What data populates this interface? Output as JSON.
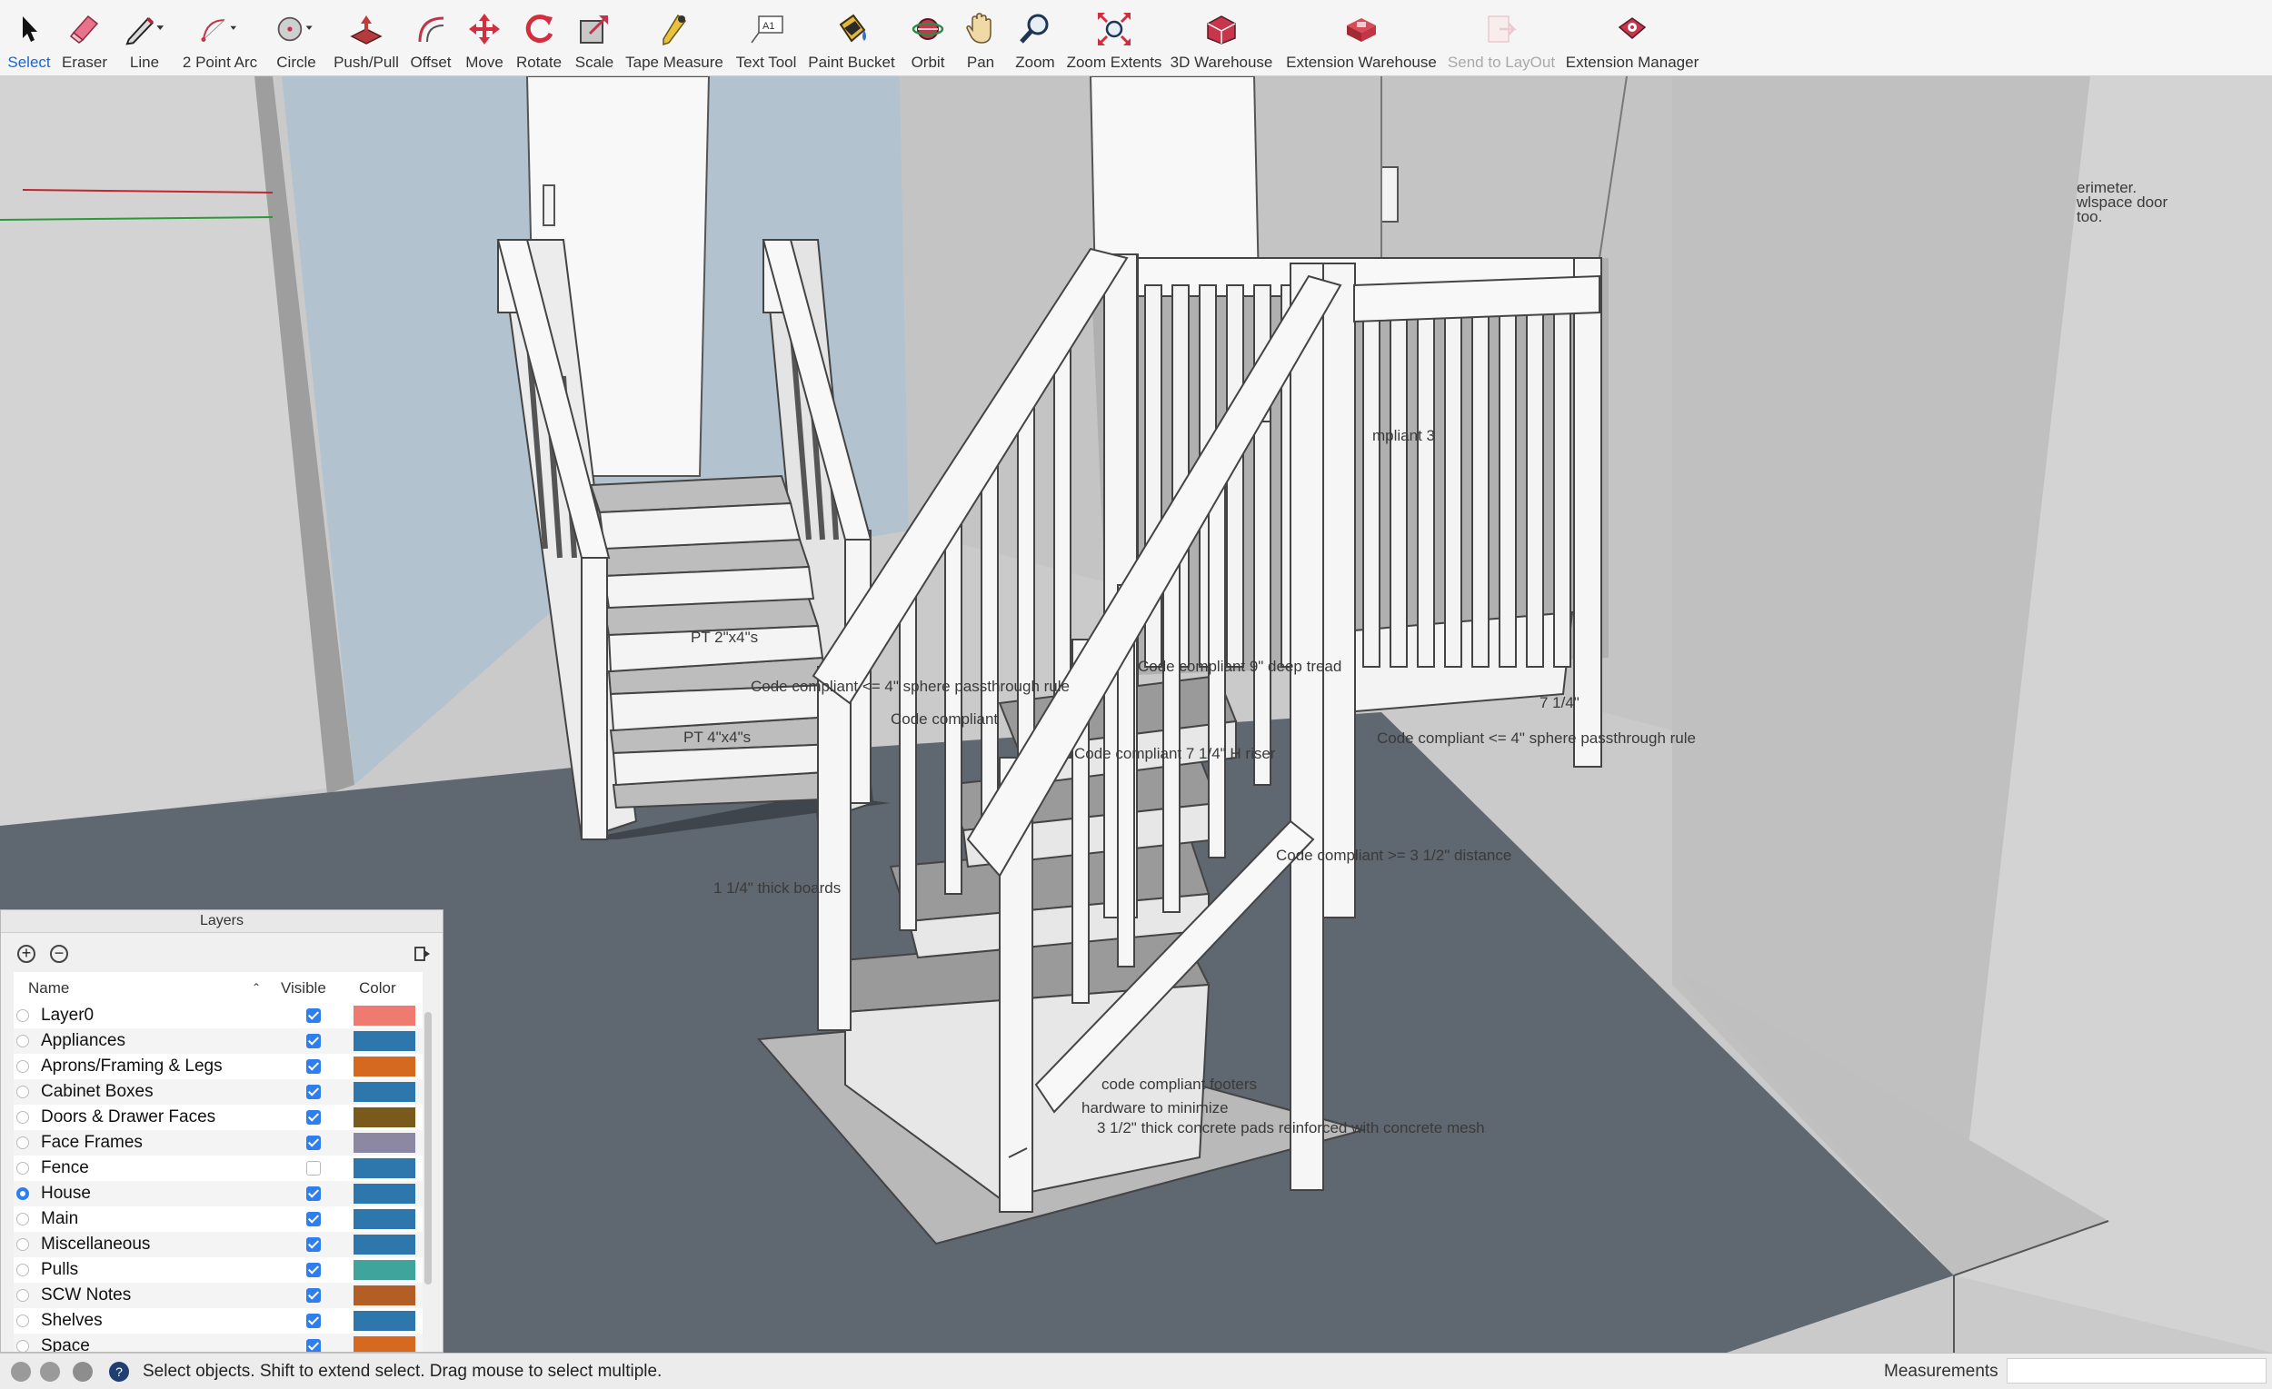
{
  "toolbar": {
    "tools": [
      {
        "label": "Select",
        "icon": "select-arrow-icon"
      },
      {
        "label": "Eraser",
        "icon": "eraser-icon"
      },
      {
        "label": "Line",
        "icon": "pencil-icon"
      },
      {
        "label": "2 Point Arc",
        "icon": "arc-icon"
      },
      {
        "label": "Circle",
        "icon": "circle-icon"
      },
      {
        "label": "Push/Pull",
        "icon": "push-pull-icon"
      },
      {
        "label": "Offset",
        "icon": "offset-icon"
      },
      {
        "label": "Move",
        "icon": "move-icon"
      },
      {
        "label": "Rotate",
        "icon": "rotate-icon"
      },
      {
        "label": "Scale",
        "icon": "scale-icon"
      },
      {
        "label": "Tape Measure",
        "icon": "tape-measure-icon"
      },
      {
        "label": "Text Tool",
        "icon": "text-tool-icon"
      },
      {
        "label": "Paint Bucket",
        "icon": "paint-bucket-icon"
      },
      {
        "label": "Orbit",
        "icon": "orbit-icon"
      },
      {
        "label": "Pan",
        "icon": "pan-hand-icon"
      },
      {
        "label": "Zoom",
        "icon": "zoom-magnifier-icon"
      },
      {
        "label": "Zoom Extents",
        "icon": "zoom-extents-icon"
      },
      {
        "label": "3D Warehouse",
        "icon": "3d-warehouse-icon"
      },
      {
        "label": "Extension Warehouse",
        "icon": "extension-warehouse-icon"
      },
      {
        "label": "Send to LayOut",
        "icon": "send-to-layout-icon"
      },
      {
        "label": "Extension Manager",
        "icon": "extension-manager-icon"
      }
    ]
  },
  "viewport": {
    "annotations": [
      "PT 2\"x4\"s",
      "Code compliant <= 4\" sphere passthrough rule",
      "Code compliant",
      "Code compliant 9\" deep tread",
      "PT 4\"x4\"s",
      "Code compliant 7 1/4\" H riser",
      "7 1/4\"",
      "Code compliant <= 4\" sphere passthrough rule",
      "Code compliant >= 3 1/2\" distance",
      "1 1/4\" thick boards",
      "code compliant footers",
      "hardware to minimize",
      "3 1/2\" thick concrete pads reinforced with concrete mesh",
      "mpliant 3",
      "erimeter.",
      "wlspace door",
      "too."
    ]
  },
  "layers_panel": {
    "title": "Layers",
    "columns": {
      "name": "Name",
      "visible": "Visible",
      "color": "Color"
    },
    "layers": [
      {
        "name": "Layer0",
        "visible": true,
        "color": "#ef7a6f",
        "active": false
      },
      {
        "name": "Appliances",
        "visible": true,
        "color": "#2e77ad",
        "active": false
      },
      {
        "name": "Aprons/Framing & Legs",
        "visible": true,
        "color": "#d4691f",
        "active": false
      },
      {
        "name": "Cabinet Boxes",
        "visible": true,
        "color": "#2e77ad",
        "active": false
      },
      {
        "name": "Doors & Drawer Faces",
        "visible": true,
        "color": "#7a5a1c",
        "active": false
      },
      {
        "name": "Face Frames",
        "visible": true,
        "color": "#8c87a3",
        "active": false
      },
      {
        "name": "Fence",
        "visible": false,
        "color": "#2e77ad",
        "active": false
      },
      {
        "name": "House",
        "visible": true,
        "color": "#2e77ad",
        "active": true
      },
      {
        "name": "Main",
        "visible": true,
        "color": "#2e77ad",
        "active": false
      },
      {
        "name": "Miscellaneous",
        "visible": true,
        "color": "#2e77ad",
        "active": false
      },
      {
        "name": "Pulls",
        "visible": true,
        "color": "#3fa59c",
        "active": false
      },
      {
        "name": "SCW Notes",
        "visible": true,
        "color": "#b35e24",
        "active": false
      },
      {
        "name": "Shelves",
        "visible": true,
        "color": "#2e77ad",
        "active": false
      },
      {
        "name": "Space",
        "visible": true,
        "color": "#d4691f",
        "active": false
      }
    ]
  },
  "statusbar": {
    "message": "Select objects. Shift to extend select. Drag mouse to select multiple.",
    "measurements_label": "Measurements",
    "measurements_value": ""
  }
}
